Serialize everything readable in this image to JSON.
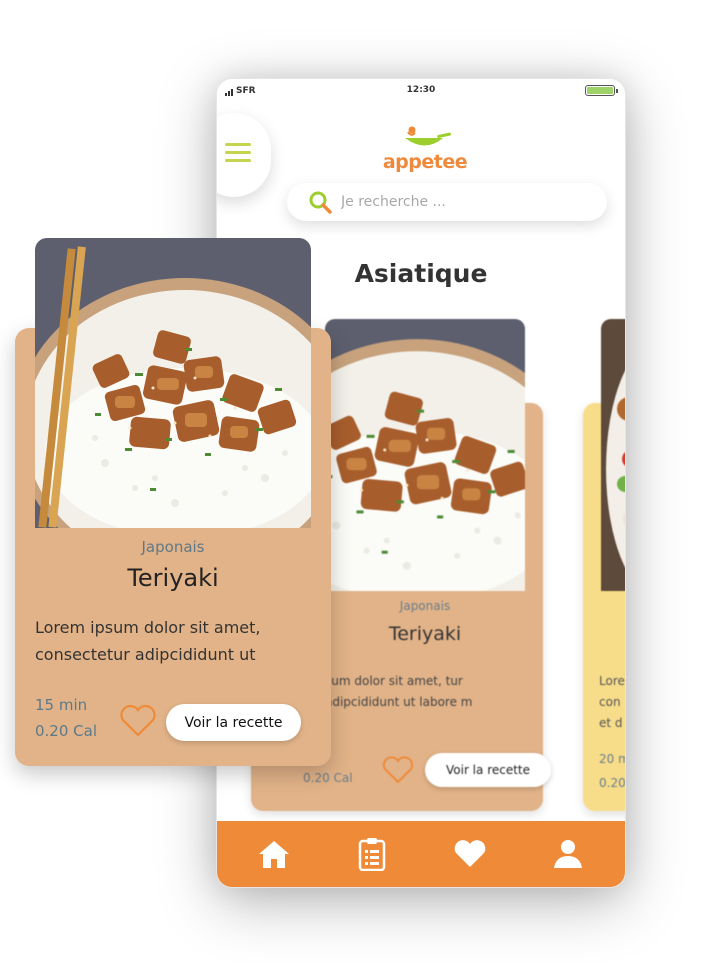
{
  "status_bar": {
    "carrier": "SFR",
    "time": "12:30",
    "battery_level": 1.0
  },
  "brand": {
    "logo_text": "appetee"
  },
  "search": {
    "placeholder": "Je recherche ..."
  },
  "section": {
    "title": "Asiatique"
  },
  "featured_card": {
    "category": "Japonais",
    "name": "Teriyaki",
    "description": "Lorem ipsum dolor sit amet, consectetur adipcididunt ut",
    "time": "15 min",
    "calories": "0.20 Cal",
    "button_label": "Voir la recette"
  },
  "cards": [
    {
      "category": "Japonais",
      "name": "Teriyaki",
      "description": "sum dolor sit amet, tur adipcididunt ut labore m",
      "calories": "0.20 Cal",
      "button_label": "Voir la recette"
    },
    {
      "description_lines": [
        "Lore",
        "con",
        "et d"
      ],
      "meta_lines": [
        "20 m",
        "0.20"
      ]
    }
  ],
  "bottom_nav": [
    {
      "icon": "home-icon"
    },
    {
      "icon": "clipboard-icon"
    },
    {
      "icon": "heart-icon"
    },
    {
      "icon": "user-icon"
    }
  ],
  "colors": {
    "accent_orange": "#ef8a38",
    "card_tan": "#e2b388",
    "card_yellow": "#f7dd8a",
    "accent_green": "#c5d34f",
    "text_blue_gray": "#5f7888"
  }
}
